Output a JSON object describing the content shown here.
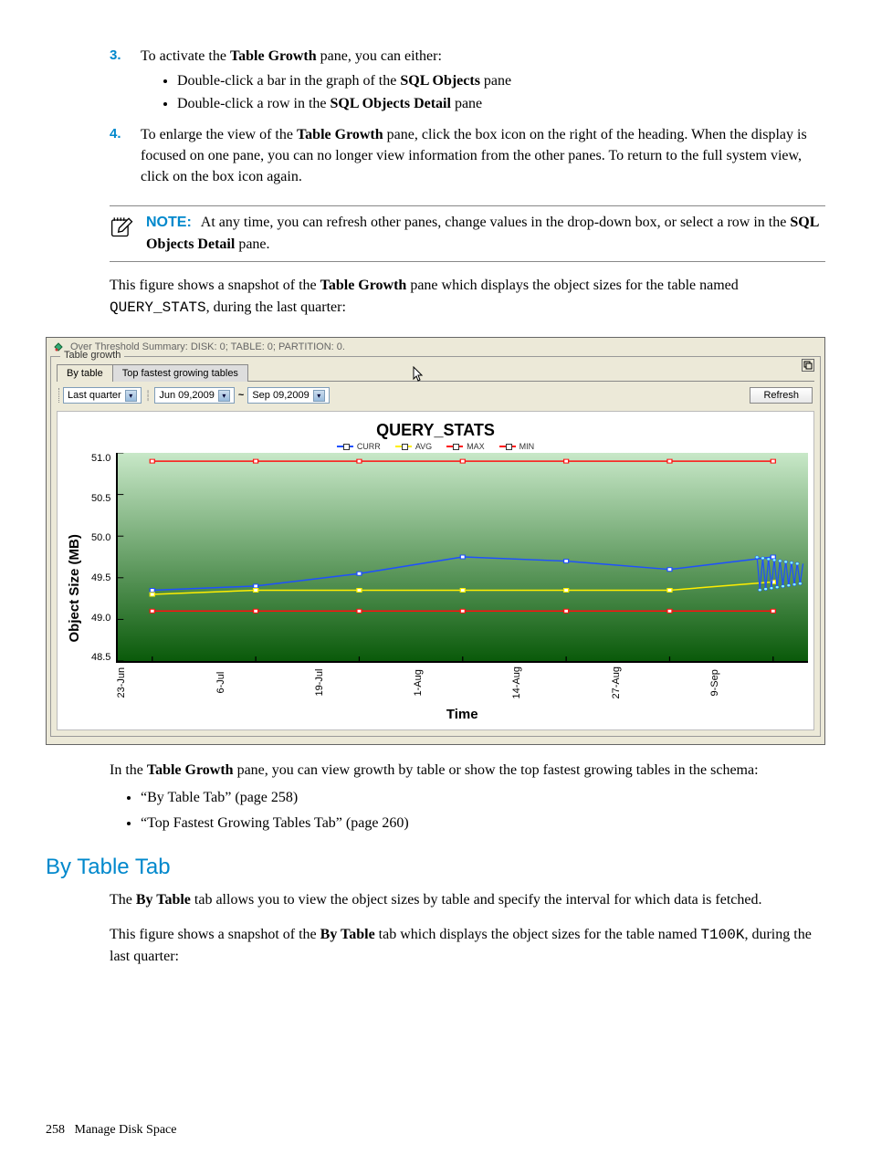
{
  "steps": {
    "s3": {
      "num": "3.",
      "text_a": "To activate the ",
      "bold_a": "Table Growth",
      "text_b": " pane, you can either:",
      "bullets": [
        {
          "pre": "Double-click a bar in the graph of the ",
          "bold": "SQL Objects",
          "post": " pane"
        },
        {
          "pre": "Double-click a row in the ",
          "bold": "SQL Objects Detail",
          "post": " pane"
        }
      ]
    },
    "s4": {
      "num": "4.",
      "text_a": "To enlarge the view of the ",
      "bold_a": "Table Growth",
      "text_b": " pane, click the box icon on the right of the heading. When the display is focused on one pane, you can no longer view information from the other panes. To return to the full system view, click on the box icon again."
    }
  },
  "note": {
    "label": "NOTE:",
    "text_a": "At any time, you can refresh other panes, change values in the drop-down box, or select a row in the ",
    "bold_a": "SQL Objects Detail",
    "text_b": " pane."
  },
  "para1": {
    "a": "This figure shows a snapshot of the ",
    "b": "Table Growth",
    "c": " pane which displays the object sizes for the table named ",
    "code": "QUERY_STATS",
    "d": ", during the last quarter:"
  },
  "figure": {
    "titlebar": "Over Threshold Summary: DISK: 0; TABLE: 0; PARTITION: 0.",
    "legend": "Table growth",
    "tabs": {
      "by_table": "By table",
      "top_fastest": "Top fastest growing tables"
    },
    "toolbar": {
      "period": "Last quarter",
      "from": "Jun 09,2009",
      "to": "Sep 09,2009",
      "refresh": "Refresh"
    },
    "chart_title": "QUERY_STATS",
    "series_labels": {
      "curr": "CURR",
      "avg": "AVG",
      "max": "MAX",
      "min": "MIN"
    },
    "y_label": "Object Size (MB)",
    "x_label": "Time"
  },
  "chart_data": {
    "type": "line",
    "title": "QUERY_STATS",
    "xlabel": "Time",
    "ylabel": "Object Size (MB)",
    "ylim": [
      48.5,
      51.0
    ],
    "categories": [
      "23-Jun",
      "6-Jul",
      "19-Jul",
      "1-Aug",
      "14-Aug",
      "27-Aug",
      "9-Sep"
    ],
    "series": [
      {
        "name": "CURR",
        "color": "#1e50ff",
        "values": [
          49.35,
          49.4,
          49.55,
          49.75,
          49.7,
          49.6,
          49.75
        ]
      },
      {
        "name": "AVG",
        "color": "#ffee00",
        "values": [
          49.3,
          49.35,
          49.35,
          49.35,
          49.35,
          49.35,
          49.45
        ]
      },
      {
        "name": "MAX",
        "color": "#ff1010",
        "values": [
          50.9,
          50.9,
          50.9,
          50.9,
          50.9,
          50.9,
          50.9
        ]
      },
      {
        "name": "MIN",
        "color": "#ff1010",
        "values": [
          49.1,
          49.1,
          49.1,
          49.1,
          49.1,
          49.1,
          49.1
        ]
      }
    ]
  },
  "para2": {
    "a": "In the ",
    "b": "Table Growth",
    "c": " pane, you can view growth by table or show the top fastest growing tables in the schema:"
  },
  "links": {
    "l1": "“By Table Tab” (page 258)",
    "l2": "“Top Fastest Growing Tables Tab” (page 260)"
  },
  "heading": "By Table Tab",
  "para3": {
    "a": "The ",
    "b": "By Table",
    "c": " tab allows you to view the object sizes by table and specify the interval for which data is fetched."
  },
  "para4": {
    "a": "This figure shows a snapshot of the ",
    "b": "By Table",
    "c": " tab which displays the object sizes for the table named ",
    "code": "T100K",
    "d": ", during the last quarter:"
  },
  "footer": {
    "page": "258",
    "section": "Manage Disk Space"
  }
}
